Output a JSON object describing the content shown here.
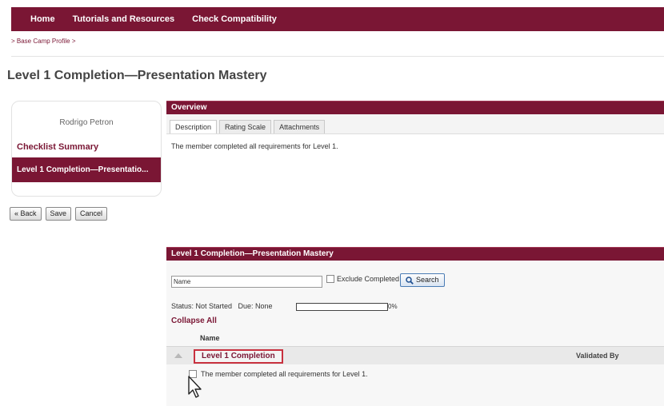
{
  "nav": {
    "items": [
      "Home",
      "Tutorials and Resources",
      "Check Compatibility"
    ]
  },
  "breadcrumb": "> Base Camp Profile >",
  "page_title": "Level 1 Completion—Presentation Mastery",
  "sidebar": {
    "member_name": "Rodrigo Petron",
    "checklist_summary": "Checklist Summary",
    "active_item": "Level 1 Completion—Presentatio..."
  },
  "buttons": {
    "back": "« Back",
    "save": "Save",
    "cancel": "Cancel"
  },
  "overview": {
    "header": "Overview",
    "tabs": [
      "Description",
      "Rating Scale",
      "Attachments"
    ],
    "description": "The member completed all requirements for Level 1."
  },
  "level_panel": {
    "header": "Level 1 Completion—Presentation Mastery",
    "search_value": "Name",
    "exclude_completed": "Exclude Completed",
    "search_button": "Search",
    "status": "Status: Not Started   Due: None",
    "progress_percent": "0%",
    "collapse_all": "Collapse All",
    "col_name": "Name",
    "row_title": "Level 1 Completion",
    "validated_by": "Validated By",
    "requirement": "The member completed all requirements for Level 1."
  },
  "colors": {
    "brand": "#7a1634",
    "highlight": "#c8313f"
  }
}
